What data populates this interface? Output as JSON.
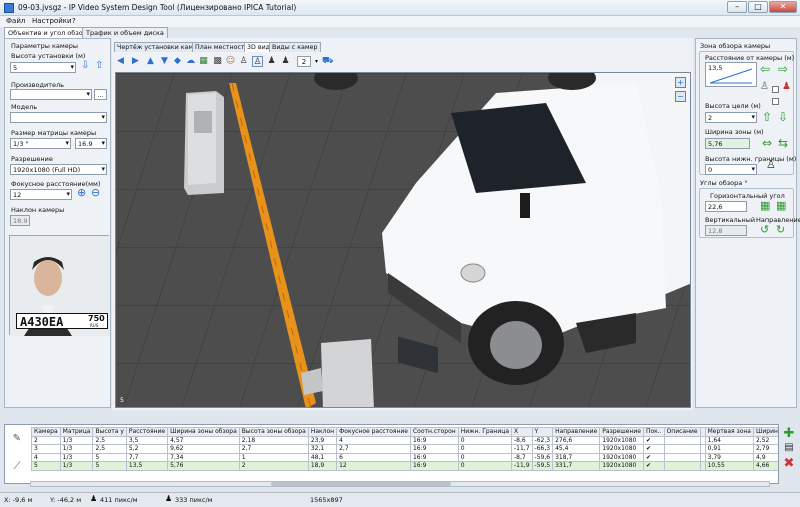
{
  "window": {
    "title": "09-03.jvsgz - IP Video System Design Tool (Лицензировано IPICA Tutorial)",
    "minimize": "–",
    "maximize": "□",
    "close": "✕"
  },
  "menu": {
    "file": "Файл",
    "settings": "Настройки",
    "help": "?"
  },
  "tabs": {
    "lens": "Объектив и угол обзора",
    "traffic": "Трафик и объем диска"
  },
  "left": {
    "camera_params": "Параметры камеры",
    "install_height_label": "Высота установки (м)",
    "install_height": "5",
    "manufacturer_label": "Производитель",
    "manufacturer": "",
    "model_label": "Модель",
    "model": "",
    "matrix_label": "Размер матрицы камеры",
    "matrix": "1/3 \"",
    "matrix_mm": "16.9",
    "resolution_label": "Разрешение",
    "resolution": "1920x1080 (Full HD)",
    "focal_label": "Фокусное расстояние(мм)",
    "focal": "12",
    "tilt_label": "Наклон камеры",
    "tilt": "18.9",
    "plate": "A430EA",
    "plate_region": "750",
    "plate_country": "RUS",
    "more_button": "..."
  },
  "view_tabs": {
    "drawing": "Чертёж установки камеры",
    "plan": "План местности",
    "view3d": "3D вид",
    "camera_views": "Виды с камер"
  },
  "toolbar": {
    "count": "2"
  },
  "scene": {
    "label": "5"
  },
  "right": {
    "zone_title": "Зона обзора камеры",
    "distance_label": "Расстояние от камеры (м)",
    "distance": "13,5",
    "target_height_label": "Высота цели (м)",
    "target_height": "2",
    "zone_width_label": "Ширина зоны (м)",
    "zone_width": "5,76",
    "lower_border_label": "Высота нижн. границы (м)",
    "lower_border": "0",
    "angles_title": "Углы обзора °",
    "h_angle_label": "Горизонтальный угол",
    "h_angle": "22,6",
    "v_label": "Вертикальный",
    "v_angle": "12,8",
    "direction_label": "Направление"
  },
  "table": {
    "headers": [
      "Камера",
      "Матрица",
      "Высота у",
      "Расстояние",
      "Ширина зоны обзора",
      "Высота зоны обзора",
      "Наклон",
      "Фокусное расстояние",
      "Соотн.сторон",
      "Нижн. Граница",
      "X",
      "Y",
      "Направление",
      "Разрешение",
      "Пок..",
      "Описание",
      "",
      "Мертвая зона",
      "Ширин"
    ],
    "rows": [
      [
        "2",
        "1/3",
        "2,5",
        "3,5",
        "4,57",
        "2,18",
        "23,9",
        "4",
        "16:9",
        "0",
        "-8,6",
        "-62,3",
        "276,6",
        "1920x1080",
        "✔",
        "",
        "",
        "1,64",
        "2,52"
      ],
      [
        "3",
        "1/3",
        "2,5",
        "5,2",
        "9,62",
        "2,7",
        "32,1",
        "2,7",
        "16:9",
        "0",
        "-11,7",
        "-66,3",
        "45,4",
        "1920x1080",
        "✔",
        "",
        "",
        "0,91",
        "2,79"
      ],
      [
        "4",
        "1/3",
        "5",
        "7,7",
        "7,34",
        "1",
        "48,1",
        "6",
        "16:9",
        "0",
        "-8,7",
        "-59,6",
        "318,7",
        "1920x1080",
        "✔",
        "",
        "",
        "3,79",
        "4,9"
      ],
      [
        "5",
        "1/3",
        "5",
        "13,5",
        "5,76",
        "2",
        "18,9",
        "12",
        "16:9",
        "0",
        "-11,9",
        "-59,5",
        "331,7",
        "1920x1080",
        "✔",
        "",
        "",
        "10,55",
        "4,66"
      ]
    ]
  },
  "status": {
    "x": "X: -9,6 м",
    "y": "Y: -46,2 м",
    "px1": "411 пикс/м",
    "px2": "333 пикс/м",
    "size": "1565x897"
  }
}
